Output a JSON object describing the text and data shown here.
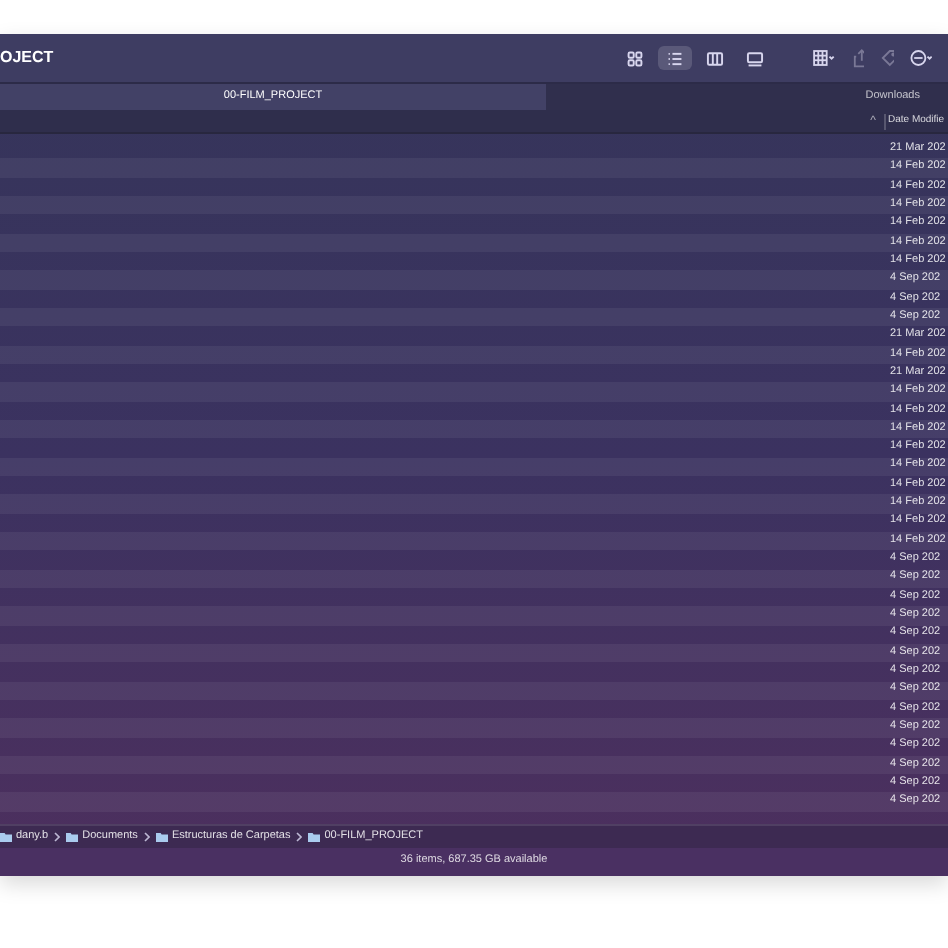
{
  "window": {
    "title": "OJECT"
  },
  "toolbar": {
    "view_buttons": [
      {
        "kind": "icons",
        "selected": false
      },
      {
        "kind": "list",
        "selected": true
      },
      {
        "kind": "columns",
        "selected": false
      },
      {
        "kind": "gallery",
        "selected": false
      }
    ],
    "actions": [
      {
        "kind": "group"
      },
      {
        "kind": "share"
      },
      {
        "kind": "tag"
      },
      {
        "kind": "more"
      }
    ]
  },
  "tabs": [
    {
      "label": "00-FILM_PROJECT",
      "selected": true
    },
    {
      "label": "Downloads",
      "selected": false
    }
  ],
  "table": {
    "sort_indicator": "^",
    "columns": [
      "Date Modifie"
    ],
    "rows": [
      {
        "date_modified": "21 Mar 202"
      },
      {
        "date_modified": "14 Feb 202"
      },
      {
        "date_modified": "14 Feb 202"
      },
      {
        "date_modified": "14 Feb 202"
      },
      {
        "date_modified": "14 Feb 202"
      },
      {
        "date_modified": "14 Feb 202"
      },
      {
        "date_modified": "14 Feb 202"
      },
      {
        "date_modified": "4 Sep 202"
      },
      {
        "date_modified": "4 Sep 202"
      },
      {
        "date_modified": "4 Sep 202"
      },
      {
        "date_modified": "21 Mar 202"
      },
      {
        "date_modified": "14 Feb 202"
      },
      {
        "date_modified": "21 Mar 202"
      },
      {
        "date_modified": "14 Feb 202"
      },
      {
        "date_modified": "14 Feb 202"
      },
      {
        "date_modified": "14 Feb 202"
      },
      {
        "date_modified": "14 Feb 202"
      },
      {
        "date_modified": "14 Feb 202"
      },
      {
        "date_modified": "14 Feb 202"
      },
      {
        "date_modified": "14 Feb 202"
      },
      {
        "date_modified": "14 Feb 202"
      },
      {
        "date_modified": "14 Feb 202"
      },
      {
        "date_modified": "4 Sep 202"
      },
      {
        "date_modified": "4 Sep 202"
      },
      {
        "date_modified": "4 Sep 202"
      },
      {
        "date_modified": "4 Sep 202"
      },
      {
        "date_modified": "4 Sep 202"
      },
      {
        "date_modified": "4 Sep 202"
      },
      {
        "date_modified": "4 Sep 202"
      },
      {
        "date_modified": "4 Sep 202"
      },
      {
        "date_modified": "4 Sep 202"
      },
      {
        "date_modified": "4 Sep 202"
      },
      {
        "date_modified": "4 Sep 202"
      },
      {
        "date_modified": "4 Sep 202"
      },
      {
        "date_modified": "4 Sep 202"
      },
      {
        "date_modified": "4 Sep 202"
      }
    ]
  },
  "path_bar": [
    "dany.b",
    "Documents",
    "Estructuras de Carpetas",
    "00-FILM_PROJECT"
  ],
  "status_bar": "36 items, 687.35 GB available"
}
